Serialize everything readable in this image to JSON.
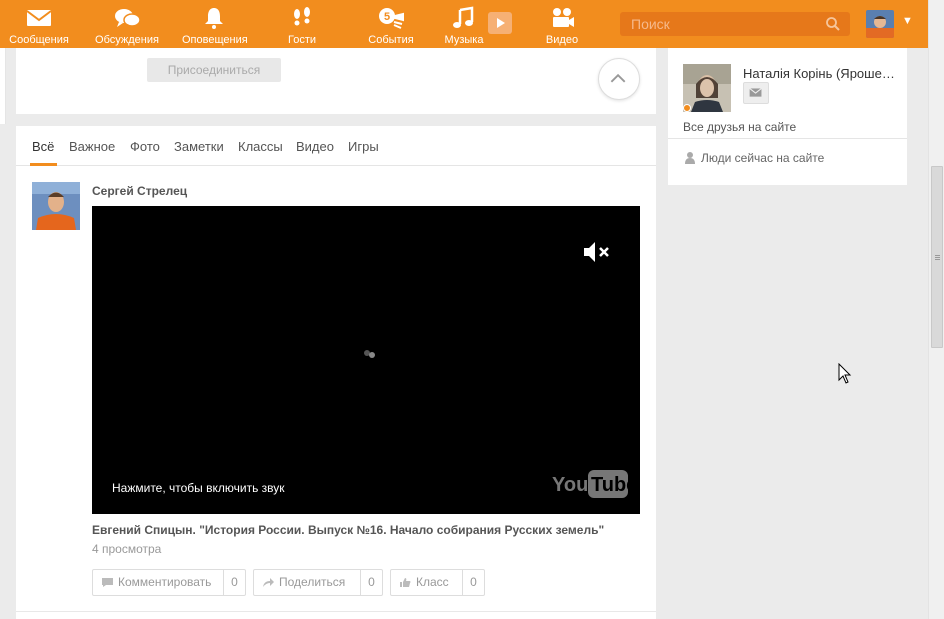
{
  "topbar": {
    "nav": [
      {
        "label": "Сообщения",
        "icon": "envelope-icon"
      },
      {
        "label": "Обсуждения",
        "icon": "chat-bubbles-icon"
      },
      {
        "label": "Оповещения",
        "icon": "bell-icon"
      },
      {
        "label": "Гости",
        "icon": "footprints-icon"
      },
      {
        "label": "События",
        "icon": "events-icon"
      },
      {
        "label": "Музыка",
        "icon": "music-note-icon"
      },
      {
        "label": "Видео",
        "icon": "video-camera-icon"
      }
    ],
    "search_placeholder": "Поиск",
    "brand_color": "#f28d1e"
  },
  "top_card": {
    "join_label": "Присоединиться"
  },
  "feed": {
    "tabs": [
      "Всё",
      "Важное",
      "Фото",
      "Заметки",
      "Классы",
      "Видео",
      "Игры"
    ],
    "active_tab": "Всё",
    "post": {
      "author": "Сергей Стрелец",
      "video_hint": "Нажмите, чтобы включить звук",
      "video_brand": "YouTube",
      "title": "Евгений Спицын. \"История России. Выпуск №16. Начало собирания Русских земель\"",
      "views": "4 просмотра",
      "actions": [
        {
          "label": "Комментировать",
          "count": "0",
          "icon": "comment-icon"
        },
        {
          "label": "Поделиться",
          "count": "0",
          "icon": "share-icon"
        },
        {
          "label": "Класс",
          "count": "0",
          "icon": "thumbs-up-icon"
        }
      ]
    }
  },
  "right_panel": {
    "friend_name": "Наталія Корінь (Яроше…",
    "all_friends_label": "Все друзья на сайте",
    "people_online_label": "Люди сейчас на сайте"
  }
}
